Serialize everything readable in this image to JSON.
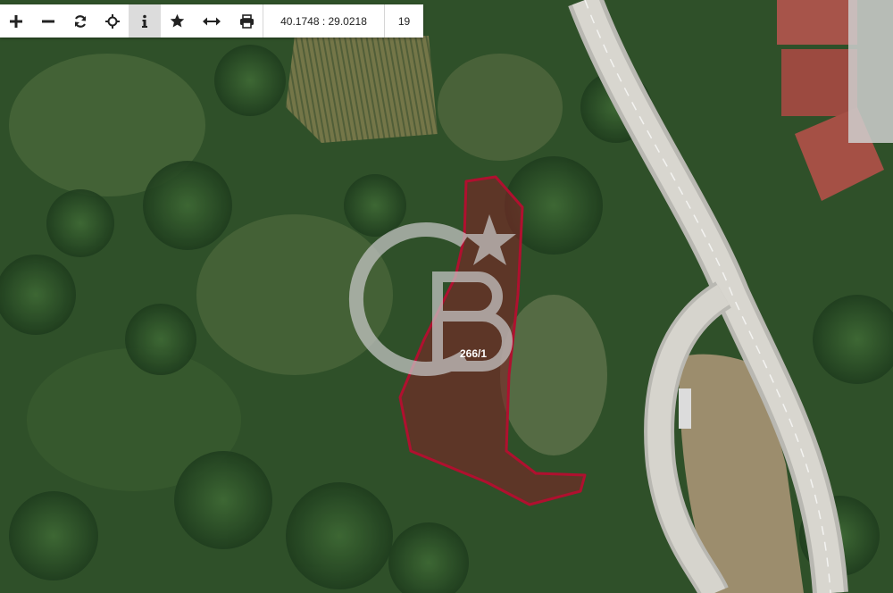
{
  "toolbar": {
    "buttons": [
      {
        "name": "zoom-in",
        "icon": "plus-icon"
      },
      {
        "name": "zoom-out",
        "icon": "minus-icon"
      },
      {
        "name": "refresh",
        "icon": "refresh-icon"
      },
      {
        "name": "locate",
        "icon": "crosshair-icon"
      },
      {
        "name": "info",
        "icon": "info-icon",
        "active": true
      },
      {
        "name": "favorite",
        "icon": "star-icon"
      },
      {
        "name": "measure",
        "icon": "arrows-horizontal-icon"
      },
      {
        "name": "print",
        "icon": "printer-icon"
      }
    ],
    "coordinates": "40.1748 : 29.0218",
    "zoom_level": "19"
  },
  "map": {
    "parcel_label": "266/1",
    "parcel_outline_color": "#b0102f",
    "parcel_fill_color": "#7a2626",
    "watermark": "CB",
    "watermark_color": "#c8c8c8"
  }
}
